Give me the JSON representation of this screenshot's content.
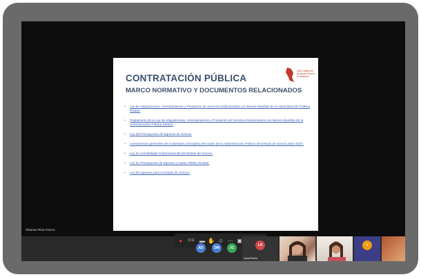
{
  "slide": {
    "title": "CONTRATACIÓN PÚBLICA",
    "subtitle": "MARCO NORMATIVO Y DOCUMENTOS RELACIONADOS",
    "logo_text": "UDA Unidad de Auditoría Sonora Contraloría",
    "bullets": [
      "Ley de Adquisiciones, Arrendamientos y Prestación de Servicios Relacionados con Bienes Muebles de la Administración Pública Estatal.",
      "Reglamento de la Ley de Adquisiciones, Arrendamientos y Prestación de Servicios Relacionados con Bienes Muebles de la Administración Pública Estatal.",
      "Ley del Presupuesto de Egresos de Sonora.",
      "Lineamientos generales de Austeridad y Disciplina del Gasto de la Administración Pública del Estado de Sonora 2021-2027.",
      "Ley de Contabilidad Gubernamental del Estado de Sonora.",
      "Ley de Presupuesto de Egresos y Gasto Público Estatal.",
      "Ley de Ingresos para el Estado de Sonora."
    ]
  },
  "meeting": {
    "presenter_label": "Shamari Ríos Franco",
    "timer": "0:11",
    "end_icon": "phone-end-icon",
    "participants": [
      {
        "initials": "AD",
        "color": "#4a7fd1"
      },
      {
        "initials": "DM",
        "color": "#4a7fd1"
      },
      {
        "initials": "JC",
        "color": "#3aa856"
      },
      {
        "initials": "LR",
        "color": "#d14a4a"
      }
    ],
    "participant_caption": "Laura Rocha"
  },
  "colors": {
    "frame": "#6a6a6a",
    "screen": "#0d0d0d",
    "title": "#3a4f6b",
    "link": "#3d62b8",
    "end_button": "#e23b3b"
  }
}
